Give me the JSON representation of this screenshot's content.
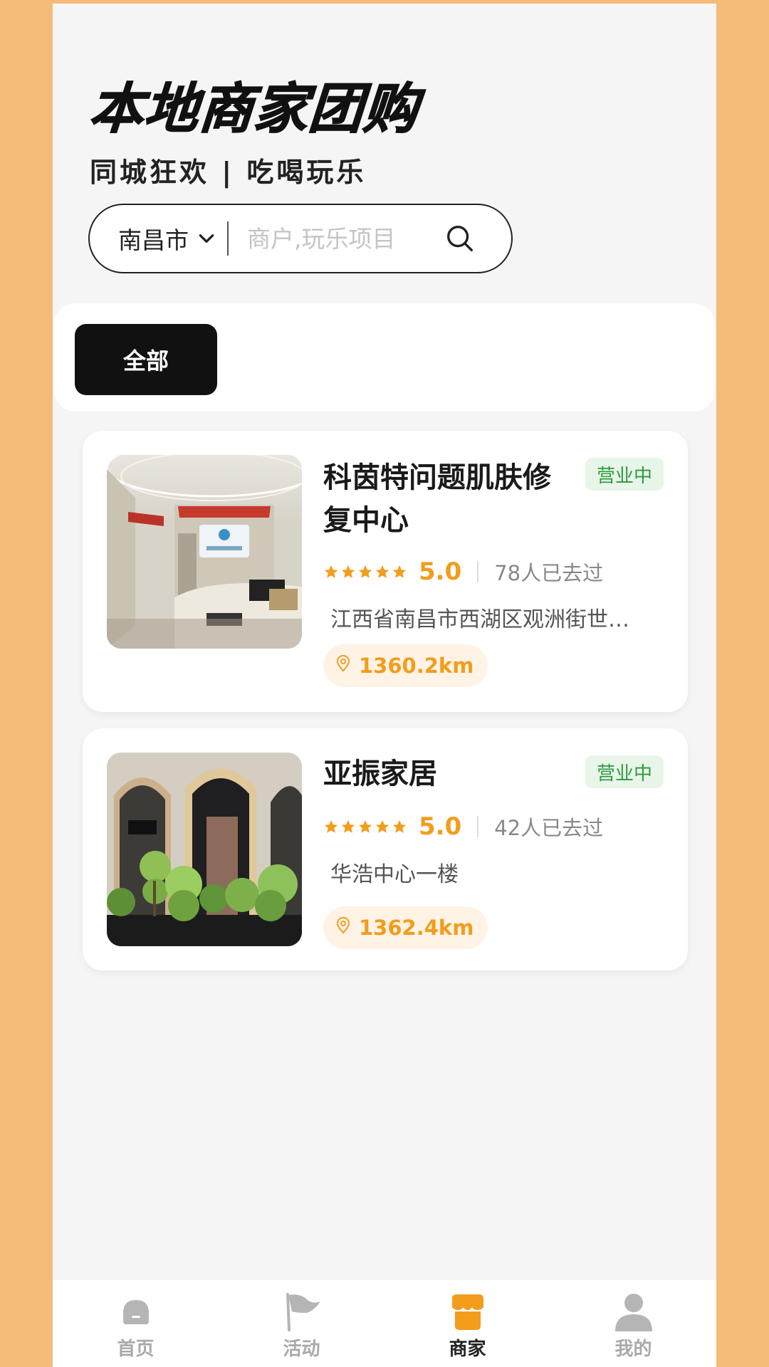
{
  "header": {
    "title": "本地商家团购",
    "subtitle": "同城狂欢 | 吃喝玩乐"
  },
  "search": {
    "city": "南昌市",
    "placeholder": "商户,玩乐项目"
  },
  "categories": [
    {
      "label": "全部",
      "active": true
    }
  ],
  "merchants": [
    {
      "name": "科茵特问题肌肤修复中心",
      "status": "营业中",
      "rating": "5.0",
      "stars": 5,
      "visited": "78人已去过",
      "address": "江西省南昌市西湖区观洲街世…",
      "distance": "1360.2km"
    },
    {
      "name": "亚振家居",
      "status": "营业中",
      "rating": "5.0",
      "stars": 5,
      "visited": "42人已去过",
      "address": "华浩中心一楼",
      "distance": "1362.4km"
    }
  ],
  "tabbar": [
    {
      "label": "首页",
      "icon": "home-icon",
      "active": false
    },
    {
      "label": "活动",
      "icon": "flag-icon",
      "active": false
    },
    {
      "label": "商家",
      "icon": "shop-icon",
      "active": true
    },
    {
      "label": "我的",
      "icon": "user-icon",
      "active": false
    }
  ],
  "colors": {
    "accent": "#f29d1c",
    "status_green": "#2e9a3e",
    "background_outer": "#f5bb78",
    "page_bg": "#f5f5f5"
  }
}
